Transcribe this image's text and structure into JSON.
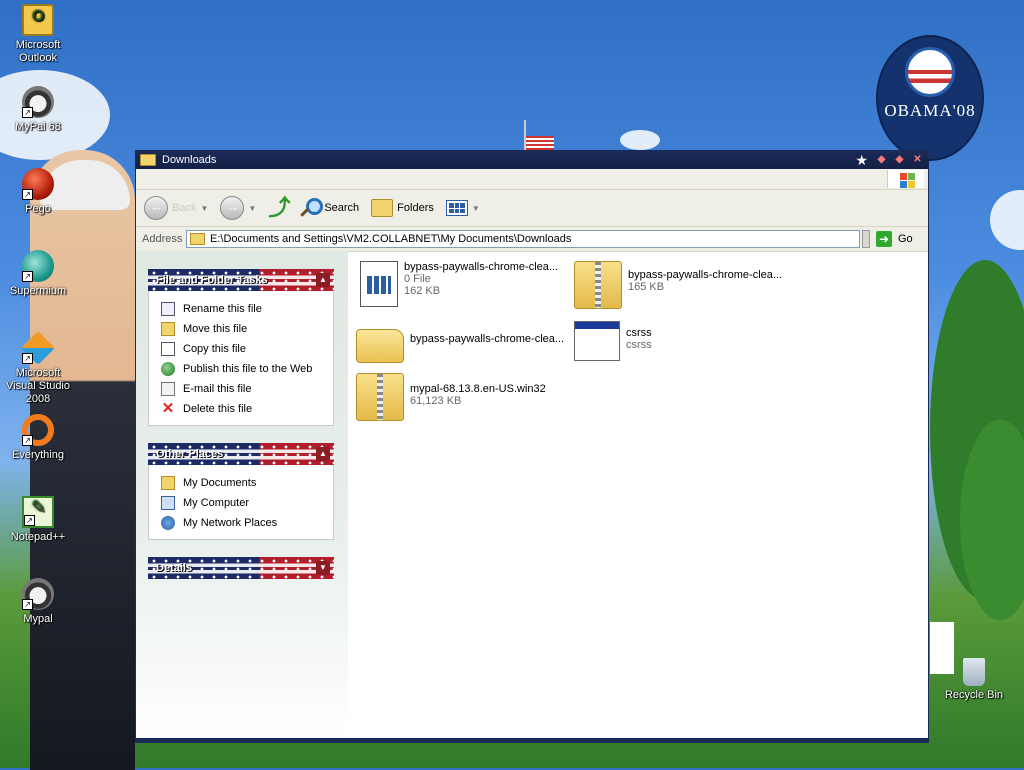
{
  "desktop": {
    "icons": [
      {
        "label": "Microsoft Outlook"
      },
      {
        "label": "MyPal 68"
      },
      {
        "label": "Pego"
      },
      {
        "label": "Supermium"
      },
      {
        "label": "Microsoft Visual Studio 2008"
      },
      {
        "label": "Everything"
      },
      {
        "label": "Notepad++"
      },
      {
        "label": "Mypal"
      },
      {
        "label": "Recycle Bin"
      }
    ],
    "wallpaper_logo": "OBAMA'08"
  },
  "window": {
    "title": "Downloads",
    "toolbar": {
      "back_label": "Back",
      "search_label": "Search",
      "folders_label": "Folders"
    },
    "address": {
      "label": "Address",
      "value": "E:\\Documents and Settings\\VM2.COLLABNET\\My Documents\\Downloads",
      "go_label": "Go"
    },
    "taskpane": {
      "file_tasks": {
        "header": "File and Folder Tasks",
        "items": [
          {
            "label": "Rename this file"
          },
          {
            "label": "Move this file"
          },
          {
            "label": "Copy this file"
          },
          {
            "label": "Publish this file to the Web"
          },
          {
            "label": "E-mail this file"
          },
          {
            "label": "Delete this file"
          }
        ]
      },
      "other_places": {
        "header": "Other Places",
        "items": [
          {
            "label": "My Documents"
          },
          {
            "label": "My Computer"
          },
          {
            "label": "My Network Places"
          }
        ]
      },
      "details": {
        "header": "Details"
      }
    },
    "files": [
      {
        "name": "bypass-paywalls-chrome-clea...",
        "line2": "0 File",
        "line3": "162 KB",
        "icon": "html-file-icon"
      },
      {
        "name": "bypass-paywalls-chrome-clea...",
        "line2": "165 KB",
        "icon": "zip-folder-icon"
      },
      {
        "name": "bypass-paywalls-chrome-clea...",
        "icon": "folder-icon"
      },
      {
        "name": "csrss",
        "line2": "csrss",
        "icon": "application-icon"
      },
      {
        "name": "mypal-68.13.8.en-US.win32",
        "line2": "61,123 KB",
        "icon": "zip-folder-icon"
      }
    ]
  },
  "colors": {
    "titlebar": "#1b2a58",
    "taskpane_header_blue": "#1c2b66",
    "taskpane_header_red": "#b21d2b"
  }
}
